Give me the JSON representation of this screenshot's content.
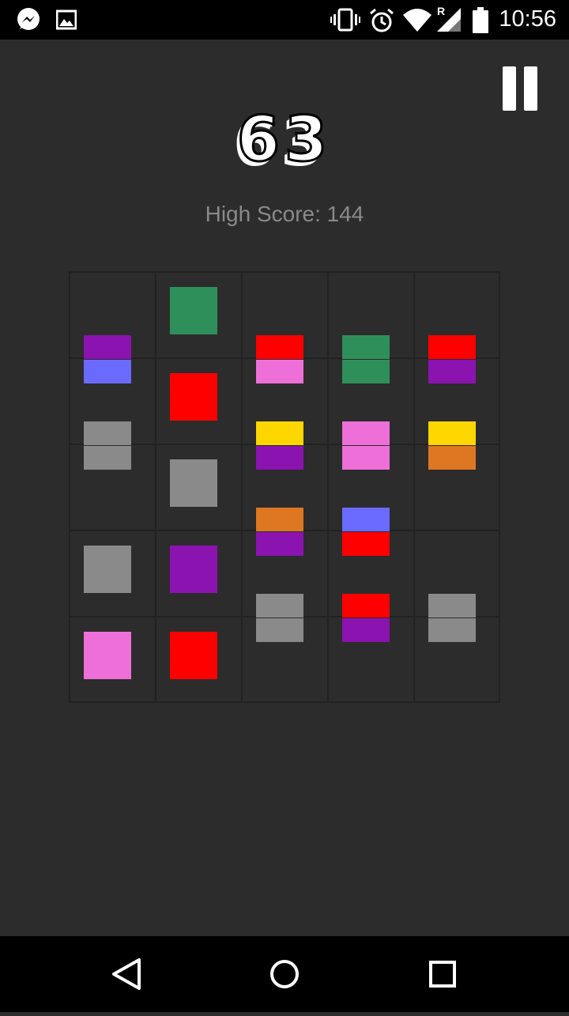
{
  "status_bar": {
    "time": "10:56",
    "left_icons": [
      "messenger-icon",
      "gallery-icon"
    ],
    "right_icons": [
      "vibrate-icon",
      "alarm-icon",
      "wifi-icon",
      "signal-roaming-icon",
      "battery-icon"
    ],
    "roaming_label": "R"
  },
  "game": {
    "score": "63",
    "high_score_label": "High Score: 144",
    "colors": {
      "purple": "#8b13b0",
      "blue": "#6a6aff",
      "green": "#2f8f5a",
      "red": "#ff0000",
      "pink": "#ee6fd8",
      "yellow": "#ffd700",
      "orange": "#de7721",
      "gray": "#8a8a8a"
    },
    "board": {
      "rows": 5,
      "cols": 5,
      "tiles": [
        {
          "type": "full",
          "row": 0,
          "col": 1,
          "color": "green"
        },
        {
          "type": "edge-v",
          "row": 0,
          "col": 0,
          "colors": [
            "purple",
            "blue"
          ]
        },
        {
          "type": "edge-v",
          "row": 0,
          "col": 2,
          "colors": [
            "red",
            "pink"
          ]
        },
        {
          "type": "edge-v",
          "row": 0,
          "col": 3,
          "colors": [
            "green",
            "green"
          ]
        },
        {
          "type": "edge-v",
          "row": 0,
          "col": 4,
          "colors": [
            "red",
            "purple"
          ]
        },
        {
          "type": "full",
          "row": 1,
          "col": 1,
          "color": "red"
        },
        {
          "type": "edge-v",
          "row": 1,
          "col": 0,
          "colors": [
            "gray",
            "gray"
          ]
        },
        {
          "type": "edge-v",
          "row": 1,
          "col": 2,
          "colors": [
            "yellow",
            "purple"
          ]
        },
        {
          "type": "edge-v",
          "row": 1,
          "col": 3,
          "colors": [
            "pink",
            "pink"
          ]
        },
        {
          "type": "edge-v",
          "row": 1,
          "col": 4,
          "colors": [
            "yellow",
            "orange"
          ]
        },
        {
          "type": "full",
          "row": 2,
          "col": 1,
          "color": "gray"
        },
        {
          "type": "edge-v",
          "row": 2,
          "col": 2,
          "colors": [
            "orange",
            "purple"
          ]
        },
        {
          "type": "edge-v",
          "row": 2,
          "col": 3,
          "colors": [
            "blue",
            "red"
          ]
        },
        {
          "type": "full",
          "row": 3,
          "col": 0,
          "color": "gray"
        },
        {
          "type": "full",
          "row": 3,
          "col": 1,
          "color": "purple"
        },
        {
          "type": "edge-v",
          "row": 3,
          "col": 2,
          "colors": [
            "gray",
            "gray"
          ]
        },
        {
          "type": "edge-v",
          "row": 3,
          "col": 3,
          "colors": [
            "red",
            "purple"
          ]
        },
        {
          "type": "edge-v",
          "row": 3,
          "col": 4,
          "colors": [
            "gray",
            "gray"
          ]
        },
        {
          "type": "full",
          "row": 4,
          "col": 0,
          "color": "pink"
        },
        {
          "type": "full",
          "row": 4,
          "col": 1,
          "color": "red"
        }
      ]
    }
  },
  "nav_bar": {
    "buttons": [
      "back-icon",
      "home-icon",
      "recents-icon"
    ]
  }
}
